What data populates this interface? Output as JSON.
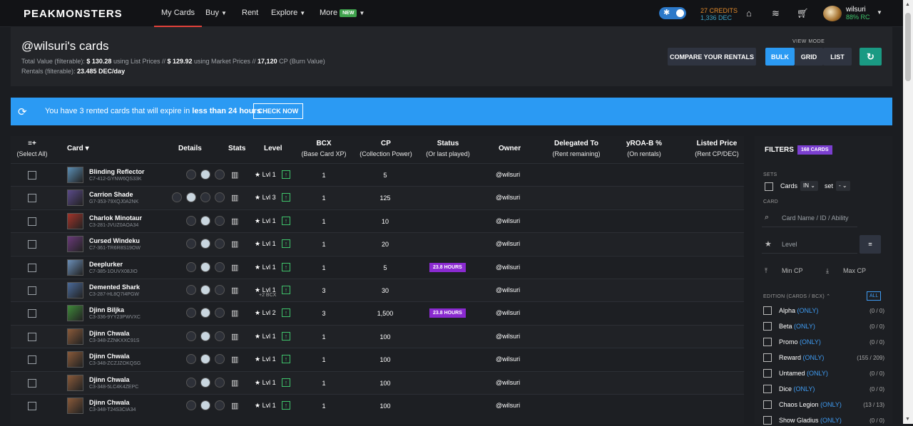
{
  "nav": {
    "logo": "PEAKMONSTERS",
    "items": [
      {
        "label": "My Cards",
        "chev": ""
      },
      {
        "label": "Buy",
        "chev": "⌄"
      },
      {
        "label": "Rent",
        "chev": ""
      },
      {
        "label": "Explore",
        "chev": "⌄"
      },
      {
        "label": "More",
        "chev": ""
      }
    ],
    "new_badge": "NEW",
    "credits": "27 CREDITS",
    "dec": "1,336 DEC",
    "username": "wilsuri",
    "rc": "88% RC"
  },
  "header": {
    "title": "@wilsuri's cards",
    "line1_a": "Total Value (filterable): ",
    "line1_b": "$ 130.28",
    "line1_c": " using List Prices //  ",
    "line1_d": "$ 129.92",
    "line1_e": " using Market Prices //  ",
    "line1_f": "17,120",
    "line1_g": " CP (Burn Value)",
    "line2_a": "Rentals (filterable): ",
    "line2_b": "23.485 DEC/day",
    "view_mode_label": "VIEW MODE",
    "compare_btn": "COMPARE YOUR RENTALS",
    "bulk": "BULK",
    "grid": "GRID",
    "list": "LIST"
  },
  "banner": {
    "text_a": "You have ",
    "text_b": "3 rented cards",
    "text_c": " that will expire in ",
    "text_d": "less than 24 hours",
    "check": "CHECK NOW"
  },
  "table": {
    "h_select": "≡+",
    "h_select_sub": "(Select All)",
    "h_card": "Card",
    "h_details": "Details",
    "h_stats": "Stats",
    "h_level": "Level",
    "h_bcx": "BCX",
    "h_bcx_sub": "(Base Card XP)",
    "h_cp": "CP",
    "h_cp_sub": "(Collection Power)",
    "h_status": "Status",
    "h_status_sub": "(Or last played)",
    "h_owner": "Owner",
    "h_delegated": "Delegated To",
    "h_delegated_sub": "(Rent remaining)",
    "h_yroa": "yROA-B %",
    "h_yroa_sub": "(On rentals)",
    "h_listed": "Listed Price",
    "h_listed_sub": "(Rent CP/DEC)",
    "rows": [
      {
        "name": "Blinding Reflector",
        "id": "C7-412-GYNW6QS33K",
        "level": "Lvl 1",
        "bcx": "1",
        "cp": "5",
        "status": "",
        "owner": "@wilsuri",
        "sub": "",
        "color": "#5b8fb5"
      },
      {
        "name": "Carrion Shade",
        "id": "G7-353-79XQJ0A2NK",
        "level": "Lvl 3",
        "bcx": "1",
        "cp": "125",
        "status": "",
        "owner": "@wilsuri",
        "sub": "",
        "color": "#5a4a8a"
      },
      {
        "name": "Charlok Minotaur",
        "id": "C3-281-JVUZ0AOA34",
        "level": "Lvl 1",
        "bcx": "1",
        "cp": "10",
        "status": "",
        "owner": "@wilsuri",
        "sub": "",
        "color": "#a3342a"
      },
      {
        "name": "Cursed Windeku",
        "id": "C7-361-TR6R8S19OW",
        "level": "Lvl 1",
        "bcx": "1",
        "cp": "20",
        "status": "",
        "owner": "@wilsuri",
        "sub": "",
        "color": "#6a3a7a"
      },
      {
        "name": "Deeplurker",
        "id": "C7-385-1OUVX08JIO",
        "level": "Lvl 1",
        "bcx": "1",
        "cp": "5",
        "status": "23.8 HOURS",
        "owner": "@wilsuri",
        "sub": "",
        "color": "#6b8fb8"
      },
      {
        "name": "Demented Shark",
        "id": "C3-287-HL8Q7I4PGW",
        "level": "Lvl 1",
        "bcx": "3",
        "cp": "30",
        "status": "",
        "owner": "@wilsuri",
        "sub": "+2 BCX",
        "color": "#4a6a9a"
      },
      {
        "name": "Djinn Biljka",
        "id": "C3-336-9YY23PWVXC",
        "level": "Lvl 2",
        "bcx": "3",
        "cp": "1,500",
        "status": "23.8 HOURS",
        "owner": "@wilsuri",
        "sub": "",
        "color": "#3f8a3a"
      },
      {
        "name": "Djinn Chwala",
        "id": "C3-348-ZZNKXXC91S",
        "level": "Lvl 1",
        "bcx": "1",
        "cp": "100",
        "status": "",
        "owner": "@wilsuri",
        "sub": "",
        "color": "#8a5a3a"
      },
      {
        "name": "Djinn Chwala",
        "id": "C3-348-ZCZJZOKQSG",
        "level": "Lvl 1",
        "bcx": "1",
        "cp": "100",
        "status": "",
        "owner": "@wilsuri",
        "sub": "",
        "color": "#8a5a3a"
      },
      {
        "name": "Djinn Chwala",
        "id": "C3-348-5LC4K4ZEPC",
        "level": "Lvl 1",
        "bcx": "1",
        "cp": "100",
        "status": "",
        "owner": "@wilsuri",
        "sub": "",
        "color": "#8a5a3a"
      },
      {
        "name": "Djinn Chwala",
        "id": "C3-348-T24S3CIA34",
        "level": "Lvl 1",
        "bcx": "1",
        "cp": "100",
        "status": "",
        "owner": "@wilsuri",
        "sub": "",
        "color": "#8a5a3a"
      }
    ]
  },
  "filters": {
    "title": "FILTERS",
    "badge": "168 CARDS",
    "sets_label": "SETS",
    "cards": "Cards",
    "in": "IN",
    "set": "set",
    "dash": "-",
    "card_label": "CARD",
    "card_placeholder": "Card Name / ID / Ability",
    "level_placeholder": "Level",
    "eq": "=",
    "min_cp": "Min CP",
    "max_cp": "Max CP",
    "edition_label": "EDITION (CARDS / BCX)",
    "all": "ALL",
    "only": "(ONLY)",
    "editions": [
      {
        "name": "Alpha",
        "count": "(0 / 0)"
      },
      {
        "name": "Beta",
        "count": "(0 / 0)"
      },
      {
        "name": "Promo",
        "count": "(0 / 0)"
      },
      {
        "name": "Reward",
        "count": "(155 / 209)"
      },
      {
        "name": "Untamed",
        "count": "(0 / 0)"
      },
      {
        "name": "Dice",
        "count": "(0 / 0)"
      },
      {
        "name": "Chaos Legion",
        "count": "(13 / 13)"
      },
      {
        "name": "Show Gladius",
        "count": "(0 / 0)"
      }
    ]
  }
}
